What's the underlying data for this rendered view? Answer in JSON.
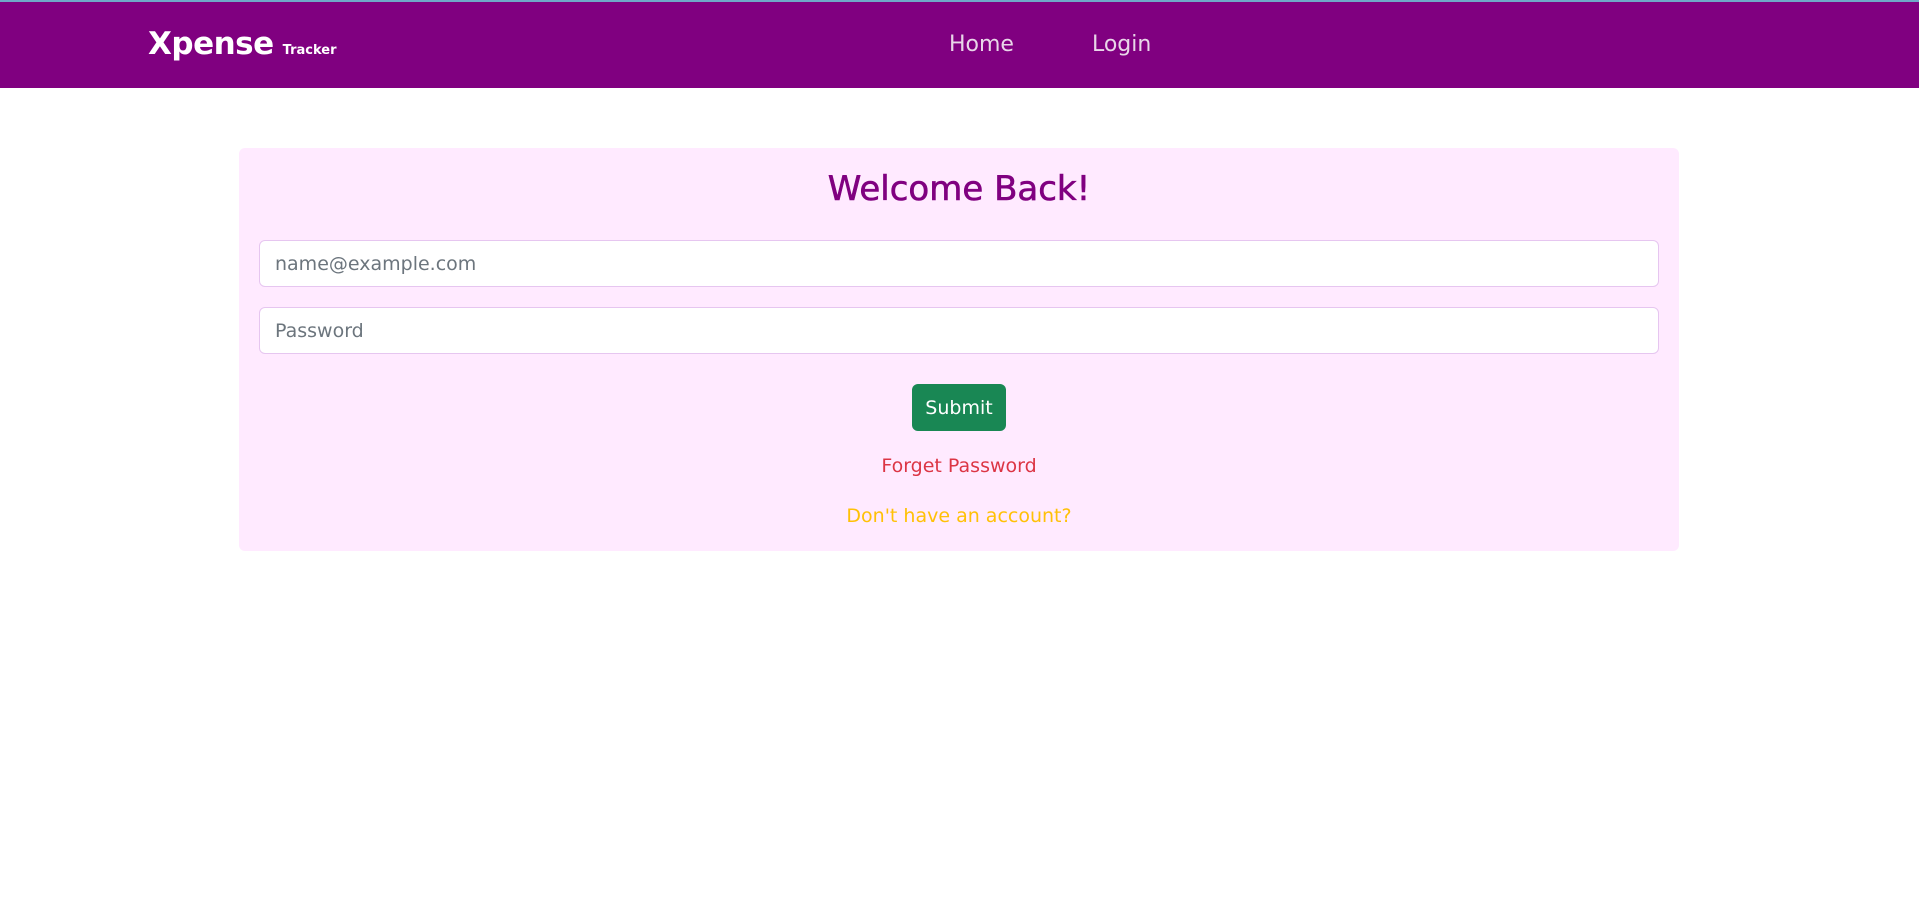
{
  "navbar": {
    "brand_main": "Xpense",
    "brand_sub": "Tracker",
    "links": [
      {
        "label": "Home"
      },
      {
        "label": "Login"
      }
    ]
  },
  "login_card": {
    "title": "Welcome Back!",
    "email_placeholder": "name@example.com",
    "password_placeholder": "Password",
    "submit_label": "Submit",
    "forgot_password_label": "Forget Password",
    "signup_label": "Don't have an account?"
  },
  "colors": {
    "navbar_bg": "#800080",
    "card_bg": "#ffeaff",
    "title": "#800080",
    "submit_bg": "#198754",
    "forgot_link": "#dc3545",
    "signup_link": "#ffc107"
  }
}
